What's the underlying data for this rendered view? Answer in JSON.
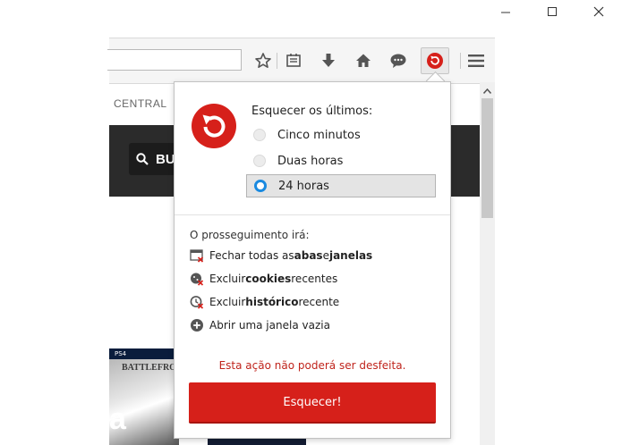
{
  "window": {
    "controls": [
      "minimize",
      "maximize",
      "close"
    ]
  },
  "toolbar": {
    "icons": [
      "star-icon",
      "reading-list-icon",
      "download-icon",
      "home-icon",
      "chat-icon",
      "forget-addon-icon",
      "menu-icon"
    ]
  },
  "page": {
    "nav_label": "CENTRAL",
    "search_label": "BU",
    "game_title": "BATTLEFRONT",
    "game_platform": "PS4",
    "big_letter": "a"
  },
  "popup": {
    "heading": "Esquecer os últimos:",
    "options": [
      {
        "label": "Cinco minutos",
        "selected": false
      },
      {
        "label": "Duas horas",
        "selected": false
      },
      {
        "label": "24 horas",
        "selected": true
      }
    ],
    "consequence_title": "O prosseguimento irá:",
    "items": [
      {
        "before": "Fechar todas as ",
        "bold1": "abas",
        "middle": " e ",
        "bold2": "janelas",
        "after": ""
      },
      {
        "before": "Excluir ",
        "bold1": "cookies",
        "middle": " recentes",
        "bold2": "",
        "after": ""
      },
      {
        "before": "Excluir ",
        "bold1": "histórico",
        "middle": " recente",
        "bold2": "",
        "after": ""
      },
      {
        "before": "Abrir uma janela vazia",
        "bold1": "",
        "middle": "",
        "bold2": "",
        "after": ""
      }
    ],
    "warning": "Esta ação não poderá ser desfeita.",
    "button_label": "Esquecer!"
  },
  "colors": {
    "accent_red": "#d6201a",
    "radio_blue": "#1a8ae0",
    "warning_red": "#c0241c"
  }
}
